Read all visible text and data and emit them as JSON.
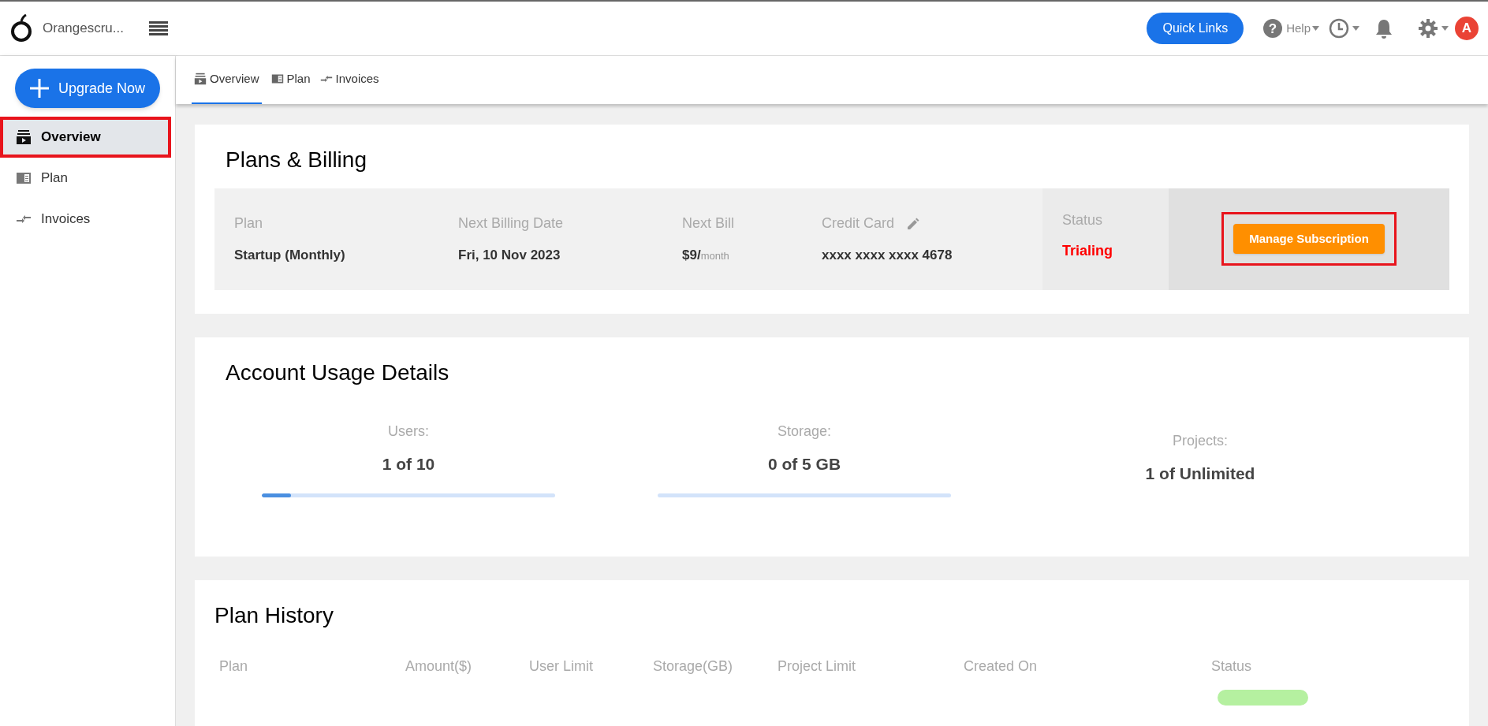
{
  "header": {
    "app_name": "Orangescru...",
    "quick_links": "Quick Links",
    "help_icon": "?",
    "help": "Help",
    "avatar": "A"
  },
  "sidebar": {
    "upgrade": "Upgrade Now",
    "items": [
      {
        "label": "Overview",
        "kind": "overview",
        "selected": true,
        "highlighted": true
      },
      {
        "label": "Plan",
        "kind": "plan",
        "selected": false,
        "highlighted": false
      },
      {
        "label": "Invoices",
        "kind": "invoices",
        "selected": false,
        "highlighted": false
      }
    ]
  },
  "tabs": [
    {
      "label": "Overview",
      "kind": "overview",
      "selected": true
    },
    {
      "label": "Plan",
      "kind": "plan",
      "selected": false
    },
    {
      "label": "Invoices",
      "kind": "invoices",
      "selected": false
    }
  ],
  "billing": {
    "title": "Plans & Billing",
    "fields": [
      {
        "label": "Plan",
        "value": "Startup (Monthly)"
      },
      {
        "label": "Next Billing Date",
        "value": "Fri, 10 Nov 2023"
      },
      {
        "label": "Next Bill",
        "value": "$9/",
        "suffix": "month"
      },
      {
        "label": "Credit Card",
        "value": "xxxx xxxx xxxx 4678",
        "editable": true
      }
    ],
    "status_label": "Status",
    "status": "Trialing",
    "manage": "Manage Subscription",
    "manage_highlighted": true
  },
  "usage": {
    "title": "Account Usage Details",
    "items": [
      {
        "label": "Users:",
        "value": "1 of 10",
        "level": 0.1
      },
      {
        "label": "Storage:",
        "value": "0 of 5 GB",
        "level": 0
      },
      {
        "label": "Projects:",
        "value": "1 of Unlimited"
      }
    ]
  },
  "history": {
    "title": "Plan History",
    "columns": [
      "Plan",
      "Amount($)",
      "User Limit",
      "Storage(GB)",
      "Project Limit",
      "Created On",
      "Status"
    ]
  }
}
